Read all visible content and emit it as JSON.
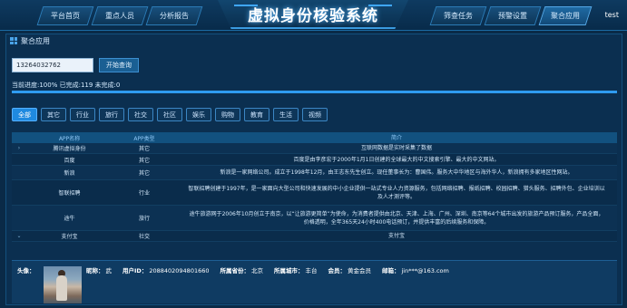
{
  "nav": {
    "left": [
      "平台首页",
      "重点人员",
      "分析报告"
    ],
    "right": [
      "筛查任务",
      "预警设置",
      "聚合应用"
    ],
    "active_right_index": 2
  },
  "app_title": "虚拟身份核验系统",
  "user": "test",
  "panel": {
    "title": "聚合应用"
  },
  "search": {
    "value": "13264032762",
    "button": "开始查询"
  },
  "progress": {
    "text": "当前进度:100% 已完成:119 未完成:0",
    "percent": 100
  },
  "tabs": [
    "全部",
    "其它",
    "行业",
    "旅行",
    "社交",
    "社区",
    "娱乐",
    "购物",
    "教育",
    "生活",
    "视频"
  ],
  "active_tab": 0,
  "table": {
    "headers": [
      "APP名称",
      "APP类型",
      "简介"
    ],
    "rows": [
      {
        "expander": "›",
        "name": "腾讯虚拟身份",
        "type": "其它",
        "desc": "互联网数据是实时采集了数据"
      },
      {
        "expander": "",
        "name": "百度",
        "type": "其它",
        "desc": "百度是由李彦宏于2000年1月1日创建的全球最大的中文搜索引擎、最大的中文网站。"
      },
      {
        "expander": "",
        "name": "新浪",
        "type": "其它",
        "desc": "新浪是一家网络公司。成立于1998年12月，由王志东先生创立。现任董事长为：曹国伟。服务大中华地区与海外华人，新浪拥有多家地区性网站。"
      },
      {
        "expander": "",
        "name": "智联招聘",
        "type": "行业",
        "desc": "智联招聘创建于1997年，是一家面向大型公司和快速发展的中小企业提供一站式专业人力资源服务，包括网络招聘、报纸招聘、校园招聘、猎头服务、招聘外包、企业培训以及人才测评等。"
      },
      {
        "expander": "",
        "name": "途牛",
        "type": "旅行",
        "desc": "途牛旅游网于2006年10月创立于南京，以“让旅游更简单”为使命，为消费者提供由北京、天津、上海、广州、深圳、南京等64个城市出发的旅游产品预订服务，产品全面，价格透明，全年365天24小时400电话预订，并提供丰富的后续服务和保障。"
      },
      {
        "expander": "⌄",
        "name": "支付宝",
        "type": "社交",
        "desc": "支付宝"
      }
    ]
  },
  "detail": {
    "avatar_label": "头像：",
    "fields": [
      {
        "label": "昵称：",
        "value": "武"
      },
      {
        "label": "用户ID：",
        "value": "2088402094801660"
      },
      {
        "label": "所属省份：",
        "value": "北京"
      },
      {
        "label": "所属城市：",
        "value": "丰台"
      },
      {
        "label": "会员：",
        "value": "黄金会员"
      },
      {
        "label": "邮箱：",
        "value": "jin***@163.com"
      }
    ]
  }
}
